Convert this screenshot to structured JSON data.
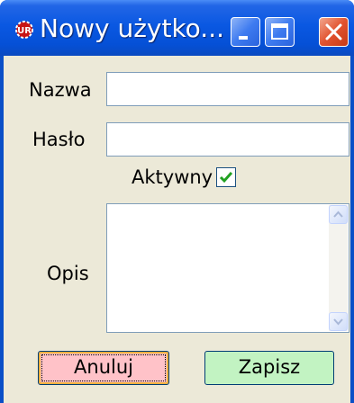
{
  "window": {
    "title": "Nowy użytko...",
    "icon": "app-logo-icon",
    "controls": [
      "minimize-icon",
      "maximize-icon",
      "close-icon"
    ]
  },
  "form": {
    "name_label": "Nazwa",
    "name_value": "",
    "password_label": "Hasło",
    "password_value": "",
    "active_label": "Aktywny",
    "active_checked": true,
    "description_label": "Opis",
    "description_value": ""
  },
  "buttons": {
    "cancel_label": "Anuluj",
    "save_label": "Zapisz"
  },
  "colors": {
    "titlebar": "#0550d6",
    "client": "#ece9d8",
    "cancel_bg": "#ffc2c8",
    "save_bg": "#c2f3c2"
  }
}
